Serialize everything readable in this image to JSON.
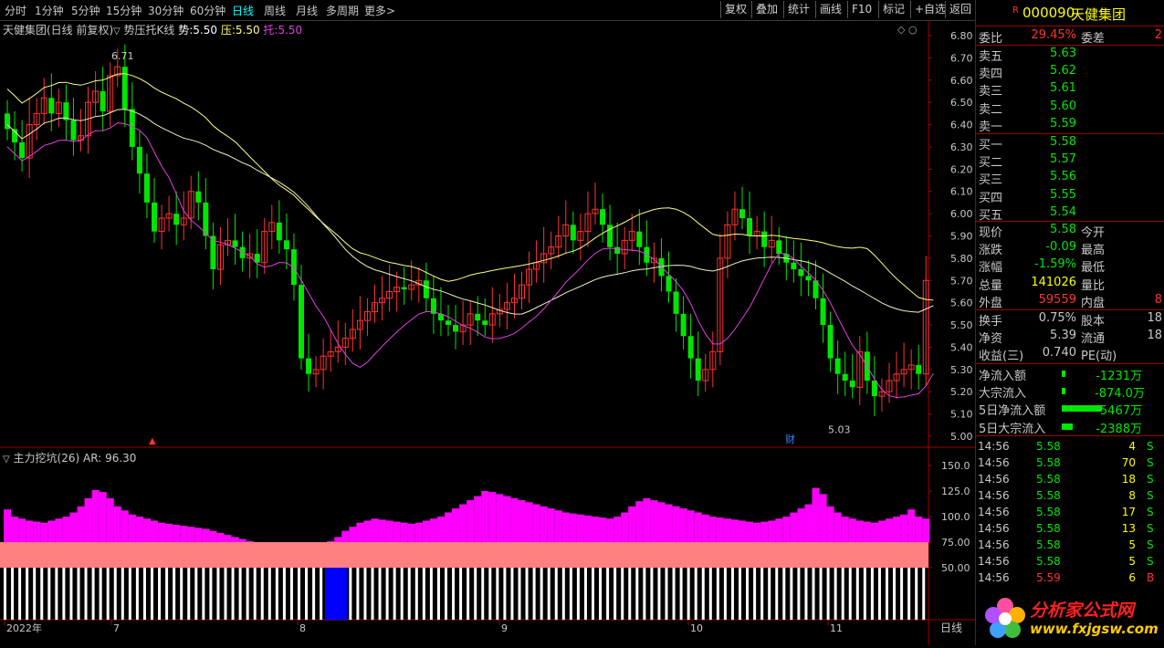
{
  "toolbar": {
    "periods": [
      "分时",
      "1分钟",
      "5分钟",
      "15分钟",
      "30分钟",
      "60分钟",
      "日线",
      "周线",
      "月线",
      "多周期",
      "更多>"
    ],
    "active_period": "日线",
    "buttons": [
      "复权",
      "叠加",
      "统计",
      "画线",
      "F10",
      "标记",
      "+自选",
      "返回"
    ]
  },
  "main_chart": {
    "title": "天健集团(日线 前复权)",
    "indicator_name": "势压托K线",
    "shi_label": "势:",
    "shi_value": "5.50",
    "ya_label": "压:",
    "ya_value": "5.50",
    "tuo_label": "托:",
    "tuo_value": "5.50",
    "high_marker": "6.71",
    "low_marker": "5.03",
    "price_ticks": [
      "6.80",
      "6.70",
      "6.60",
      "6.50",
      "6.40",
      "6.30",
      "6.20",
      "6.10",
      "6.00",
      "5.90",
      "5.80",
      "5.70",
      "5.60",
      "5.50",
      "5.40",
      "5.30",
      "5.20",
      "5.10",
      "5.00"
    ],
    "finance_marker": "财"
  },
  "sub_chart": {
    "title": "主力挖坑(26)",
    "ar_label": "AR:",
    "ar_value": "96.30",
    "ticks": [
      "150.0",
      "125.0",
      "100.0",
      "75.00",
      "50.00"
    ]
  },
  "date_axis": {
    "labels": [
      "2022年",
      "7",
      "8",
      "9",
      "10",
      "11"
    ],
    "period_label": "日线"
  },
  "colors": {
    "up": "#ff3232",
    "down": "#00e600",
    "magenta_bar": "#ff00ff",
    "salmon_bar": "#ff8080",
    "blue_bar": "#0000ff",
    "axis_red": "#a00000",
    "yellow_line": "#ffff80",
    "white_line": "#f0f0c0",
    "purple_line": "#e040e0"
  },
  "quote": {
    "code": "000090",
    "name": "天健集团",
    "weibi_label": "委比",
    "weibi_value": "29.45%",
    "weicha_label": "委差",
    "weicha_value": "2",
    "asks": [
      {
        "label": "卖五",
        "price": "5.63"
      },
      {
        "label": "卖四",
        "price": "5.62"
      },
      {
        "label": "卖三",
        "price": "5.61"
      },
      {
        "label": "卖二",
        "price": "5.60"
      },
      {
        "label": "卖一",
        "price": "5.59"
      }
    ],
    "bids": [
      {
        "label": "买一",
        "price": "5.58"
      },
      {
        "label": "买二",
        "price": "5.57"
      },
      {
        "label": "买三",
        "price": "5.56"
      },
      {
        "label": "买四",
        "price": "5.55"
      },
      {
        "label": "买五",
        "price": "5.54"
      }
    ],
    "stats": [
      {
        "l1": "现价",
        "v1": "5.58",
        "c1": "#00e600",
        "l2": "今开",
        "v2": ""
      },
      {
        "l1": "涨跌",
        "v1": "-0.09",
        "c1": "#00e600",
        "l2": "最高",
        "v2": ""
      },
      {
        "l1": "涨幅",
        "v1": "-1.59%",
        "c1": "#00e600",
        "l2": "最低",
        "v2": ""
      },
      {
        "l1": "总量",
        "v1": "141026",
        "c1": "#ffff00",
        "l2": "量比",
        "v2": ""
      },
      {
        "l1": "外盘",
        "v1": "59559",
        "c1": "#ff3232",
        "l2": "内盘",
        "v2": "8"
      }
    ],
    "stats2": [
      {
        "l1": "换手",
        "v1": "0.75%",
        "l2": "股本",
        "v2": "18"
      },
      {
        "l1": "净资",
        "v1": "5.39",
        "l2": "流通",
        "v2": "18"
      },
      {
        "l1": "收益(三)",
        "v1": "0.740",
        "l2": "PE(动)",
        "v2": ""
      }
    ],
    "flows": [
      {
        "label": "净流入额",
        "value": "-1231万",
        "bar": 0.03
      },
      {
        "label": "大宗流入",
        "value": "-874.0万",
        "bar": 0.03
      },
      {
        "label": "5日净流入额",
        "value": "-5467万",
        "bar": 0.55
      },
      {
        "label": "5日大宗流入",
        "value": "-2388万",
        "bar": 0.15
      }
    ],
    "ticks": [
      {
        "time": "14:56",
        "price": "5.58",
        "vol": "4",
        "side": "S"
      },
      {
        "time": "14:56",
        "price": "5.58",
        "vol": "70",
        "side": "S"
      },
      {
        "time": "14:56",
        "price": "5.58",
        "vol": "18",
        "side": "S"
      },
      {
        "time": "14:56",
        "price": "5.58",
        "vol": "8",
        "side": "S"
      },
      {
        "time": "14:56",
        "price": "5.58",
        "vol": "17",
        "side": "S"
      },
      {
        "time": "14:56",
        "price": "5.58",
        "vol": "13",
        "side": "S"
      },
      {
        "time": "14:56",
        "price": "5.58",
        "vol": "5",
        "side": "S"
      },
      {
        "time": "14:56",
        "price": "5.58",
        "vol": "5",
        "side": "S"
      },
      {
        "time": "14:56",
        "price": "5.59",
        "vol": "6",
        "side": "B"
      }
    ]
  },
  "watermark": {
    "cn": "分析家公式网",
    "url": "www.fxjgsw.com"
  }
}
